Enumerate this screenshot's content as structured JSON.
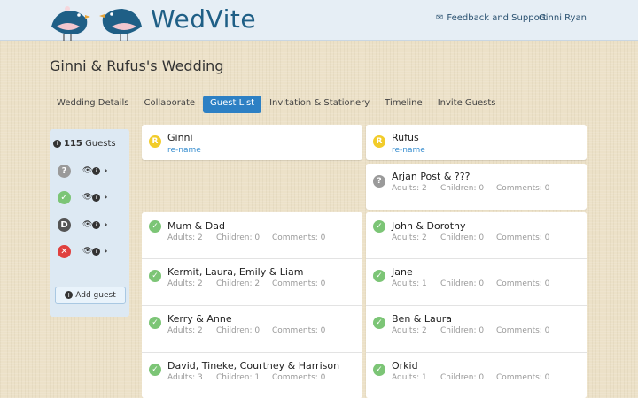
{
  "brand": {
    "name": "WedVite"
  },
  "header": {
    "feedback_label": "Feedback and Support",
    "user_name": "Ginni Ryan"
  },
  "page": {
    "title": "Ginni & Rufus's Wedding"
  },
  "tabs": [
    {
      "label": "Wedding Details"
    },
    {
      "label": "Collaborate"
    },
    {
      "label": "Guest List",
      "active": true
    },
    {
      "label": "Invitation & Stationery"
    },
    {
      "label": "Timeline"
    },
    {
      "label": "Invite Guests"
    }
  ],
  "sidebar": {
    "count": "115",
    "count_label": "Guests",
    "filters": [
      {
        "status": "unknown",
        "glyph": "?",
        "color": "#9a9a9a"
      },
      {
        "status": "accepted",
        "glyph": "✓",
        "color": "#7cc576"
      },
      {
        "status": "D",
        "glyph": "D",
        "color": "#555555"
      },
      {
        "status": "declined",
        "glyph": "✕",
        "color": "#e0403e"
      }
    ],
    "add_guest_label": "Add guest"
  },
  "hosts": [
    {
      "initial": "R",
      "name": "Ginni",
      "rename": "re-name",
      "color": "#f2cc2a"
    },
    {
      "initial": "R",
      "name": "Rufus",
      "rename": "re-name",
      "color": "#f2cc2a"
    }
  ],
  "guests_right_top": {
    "name": "Arjan Post & ???",
    "adults": "Adults: 2",
    "children": "Children: 0",
    "comments": "Comments: 0"
  },
  "guests_left": [
    {
      "name": "Mum & Dad",
      "adults": "Adults: 2",
      "children": "Children: 0",
      "comments": "Comments: 0"
    },
    {
      "name": "Kermit, Laura, Emily & Liam",
      "adults": "Adults: 2",
      "children": "Children: 2",
      "comments": "Comments: 0"
    },
    {
      "name": "Kerry & Anne",
      "adults": "Adults: 2",
      "children": "Children: 0",
      "comments": "Comments: 0"
    },
    {
      "name": "David, Tineke, Courtney & Harrison",
      "adults": "Adults: 3",
      "children": "Children: 1",
      "comments": "Comments: 0"
    }
  ],
  "guests_right": [
    {
      "name": "John & Dorothy",
      "adults": "Adults: 2",
      "children": "Children: 0",
      "comments": "Comments: 0"
    },
    {
      "name": "Jane",
      "adults": "Adults: 1",
      "children": "Children: 0",
      "comments": "Comments: 0"
    },
    {
      "name": "Ben & Laura",
      "adults": "Adults: 2",
      "children": "Children: 0",
      "comments": "Comments: 0"
    },
    {
      "name": "Orkid",
      "adults": "Adults: 1",
      "children": "Children: 0",
      "comments": "Comments: 0"
    }
  ],
  "colors": {
    "accent": "#2d80c4",
    "accepted": "#7cc576",
    "unknown": "#9a9a9a",
    "host": "#f2cc2a",
    "brand": "#1f5f86"
  }
}
